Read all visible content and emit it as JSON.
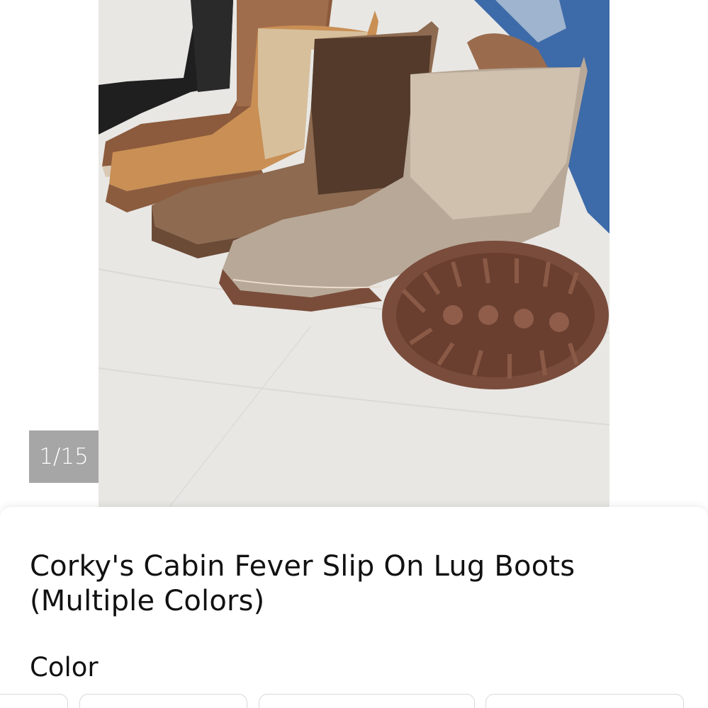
{
  "gallery": {
    "counter": "1/15",
    "image_icon": "product-photo-boots"
  },
  "product": {
    "title": "Corky's Cabin Fever Slip On Lug Boots (Multiple Colors)",
    "color_label": "Color"
  },
  "colors": {
    "sheet_bg": "#ffffff",
    "counter_bg": "#a6a6a6",
    "text": "#111111"
  }
}
